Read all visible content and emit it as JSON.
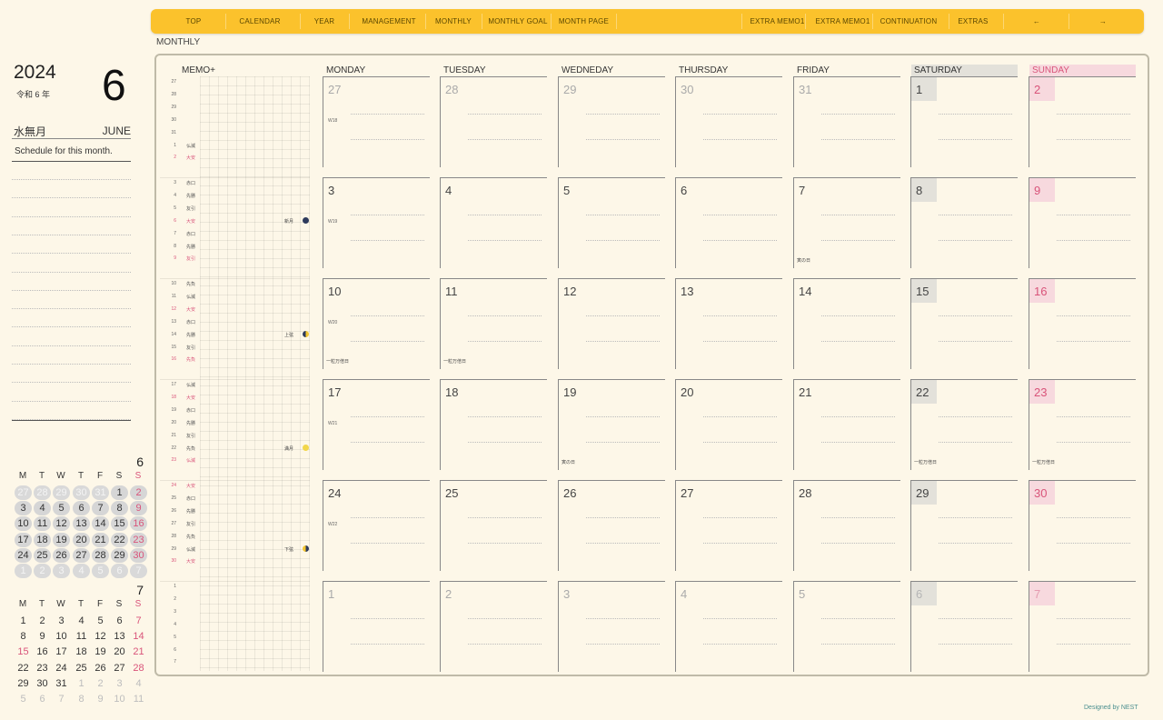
{
  "nav": {
    "items": [
      "TOP",
      "CALENDAR",
      "YEAR",
      "MANAGEMENT",
      "MONTHLY",
      "MONTHLY GOAL",
      "MONTH PAGE",
      "EXTRA MEMO1",
      "EXTRA MEMO1",
      "CONTINUATION",
      "EXTRAS",
      "←",
      "→"
    ]
  },
  "page_label": "MONTHLY",
  "header": {
    "year": "2024",
    "era": "令和 6 年",
    "month_number": "6",
    "month_jp": "水無月",
    "month_en": "JUNE",
    "schedule_title": "Schedule for this month."
  },
  "mini_calendars": [
    {
      "label": "6",
      "weekdays": [
        "M",
        "T",
        "W",
        "T",
        "F",
        "S",
        "S"
      ],
      "shaded": true,
      "weeks": [
        [
          {
            "d": "27",
            "g": true
          },
          {
            "d": "28",
            "g": true
          },
          {
            "d": "29",
            "g": true
          },
          {
            "d": "30",
            "g": true
          },
          {
            "d": "31",
            "g": true
          },
          {
            "d": "1"
          },
          {
            "d": "2"
          }
        ],
        [
          {
            "d": "3"
          },
          {
            "d": "4"
          },
          {
            "d": "5"
          },
          {
            "d": "6"
          },
          {
            "d": "7"
          },
          {
            "d": "8"
          },
          {
            "d": "9"
          }
        ],
        [
          {
            "d": "10"
          },
          {
            "d": "11"
          },
          {
            "d": "12"
          },
          {
            "d": "13"
          },
          {
            "d": "14"
          },
          {
            "d": "15"
          },
          {
            "d": "16"
          }
        ],
        [
          {
            "d": "17"
          },
          {
            "d": "18"
          },
          {
            "d": "19"
          },
          {
            "d": "20"
          },
          {
            "d": "21"
          },
          {
            "d": "22"
          },
          {
            "d": "23"
          }
        ],
        [
          {
            "d": "24"
          },
          {
            "d": "25"
          },
          {
            "d": "26"
          },
          {
            "d": "27"
          },
          {
            "d": "28"
          },
          {
            "d": "29"
          },
          {
            "d": "30"
          }
        ],
        [
          {
            "d": "1",
            "g": true
          },
          {
            "d": "2",
            "g": true
          },
          {
            "d": "3",
            "g": true
          },
          {
            "d": "4",
            "g": true
          },
          {
            "d": "5",
            "g": true
          },
          {
            "d": "6",
            "g": true
          },
          {
            "d": "7",
            "g": true
          }
        ]
      ]
    },
    {
      "label": "7",
      "weekdays": [
        "M",
        "T",
        "W",
        "T",
        "F",
        "S",
        "S"
      ],
      "shaded": false,
      "weeks": [
        [
          {
            "d": "1"
          },
          {
            "d": "2"
          },
          {
            "d": "3"
          },
          {
            "d": "4"
          },
          {
            "d": "5"
          },
          {
            "d": "6"
          },
          {
            "d": "7"
          }
        ],
        [
          {
            "d": "8"
          },
          {
            "d": "9"
          },
          {
            "d": "10"
          },
          {
            "d": "11"
          },
          {
            "d": "12"
          },
          {
            "d": "13"
          },
          {
            "d": "14"
          }
        ],
        [
          {
            "d": "15",
            "r": true
          },
          {
            "d": "16"
          },
          {
            "d": "17"
          },
          {
            "d": "18"
          },
          {
            "d": "19"
          },
          {
            "d": "20"
          },
          {
            "d": "21"
          }
        ],
        [
          {
            "d": "22"
          },
          {
            "d": "23"
          },
          {
            "d": "24"
          },
          {
            "d": "25"
          },
          {
            "d": "26"
          },
          {
            "d": "27"
          },
          {
            "d": "28"
          }
        ],
        [
          {
            "d": "29"
          },
          {
            "d": "30"
          },
          {
            "d": "31"
          },
          {
            "d": "1",
            "g": true
          },
          {
            "d": "2",
            "g": true
          },
          {
            "d": "3",
            "g": true
          },
          {
            "d": "4",
            "g": true
          }
        ],
        [
          {
            "d": "5",
            "g": true
          },
          {
            "d": "6",
            "g": true
          },
          {
            "d": "7",
            "g": true
          },
          {
            "d": "8",
            "g": true
          },
          {
            "d": "9",
            "g": true
          },
          {
            "d": "10",
            "g": true
          },
          {
            "d": "11",
            "g": true
          }
        ]
      ]
    }
  ],
  "memo": {
    "label": "MEMO+",
    "blocks": [
      [
        {
          "d": "27"
        },
        {
          "d": "28"
        },
        {
          "d": "29"
        },
        {
          "d": "30"
        },
        {
          "d": "31"
        },
        {
          "d": "1",
          "r": "仏滅"
        },
        {
          "d": "2",
          "r": "大安",
          "red": true
        }
      ],
      [
        {
          "d": "3",
          "r": "赤口"
        },
        {
          "d": "4",
          "r": "先勝"
        },
        {
          "d": "5",
          "r": "友引"
        },
        {
          "d": "6",
          "r": "大安",
          "red": true,
          "moon": "新月"
        },
        {
          "d": "7",
          "r": "赤口"
        },
        {
          "d": "8",
          "r": "先勝"
        },
        {
          "d": "9",
          "r": "友引",
          "red": true
        }
      ],
      [
        {
          "d": "10",
          "r": "先負"
        },
        {
          "d": "11",
          "r": "仏滅"
        },
        {
          "d": "12",
          "r": "大安",
          "red": true
        },
        {
          "d": "13",
          "r": "赤口"
        },
        {
          "d": "14",
          "r": "先勝",
          "moon": "上弦"
        },
        {
          "d": "15",
          "r": "友引"
        },
        {
          "d": "16",
          "r": "先負",
          "red": true
        }
      ],
      [
        {
          "d": "17",
          "r": "仏滅"
        },
        {
          "d": "18",
          "r": "大安",
          "red": true
        },
        {
          "d": "19",
          "r": "赤口"
        },
        {
          "d": "20",
          "r": "先勝"
        },
        {
          "d": "21",
          "r": "友引"
        },
        {
          "d": "22",
          "r": "先負",
          "moon": "満月"
        },
        {
          "d": "23",
          "r": "仏滅",
          "red": true
        }
      ],
      [
        {
          "d": "24",
          "r": "大安",
          "red": true
        },
        {
          "d": "25",
          "r": "赤口"
        },
        {
          "d": "26",
          "r": "先勝"
        },
        {
          "d": "27",
          "r": "友引"
        },
        {
          "d": "28",
          "r": "先負"
        },
        {
          "d": "29",
          "r": "仏滅",
          "moon": "下弦"
        },
        {
          "d": "30",
          "r": "大安",
          "red": true
        }
      ],
      [
        {
          "d": "1"
        },
        {
          "d": "2"
        },
        {
          "d": "3"
        },
        {
          "d": "4"
        },
        {
          "d": "5"
        },
        {
          "d": "6"
        },
        {
          "d": "7"
        }
      ]
    ]
  },
  "weekday_headers": [
    "MONDAY",
    "TUESDAY",
    "WEDNEDAY",
    "THURSDAY",
    "FRIDAY",
    "SATURDAY",
    "SUNDAY"
  ],
  "weeks": [
    {
      "week": "W18",
      "days": [
        {
          "d": "27",
          "g": true
        },
        {
          "d": "28",
          "g": true
        },
        {
          "d": "29",
          "g": true
        },
        {
          "d": "30",
          "g": true
        },
        {
          "d": "31",
          "g": true
        },
        {
          "d": "1"
        },
        {
          "d": "2"
        }
      ]
    },
    {
      "week": "W19",
      "days": [
        {
          "d": "3"
        },
        {
          "d": "4"
        },
        {
          "d": "5"
        },
        {
          "d": "6"
        },
        {
          "d": "7",
          "note": "寅の日"
        },
        {
          "d": "8"
        },
        {
          "d": "9"
        }
      ]
    },
    {
      "week": "W20",
      "days": [
        {
          "d": "10",
          "note": "一粒万倍日"
        },
        {
          "d": "11",
          "note": "一粒万倍日"
        },
        {
          "d": "12"
        },
        {
          "d": "13"
        },
        {
          "d": "14"
        },
        {
          "d": "15"
        },
        {
          "d": "16"
        }
      ]
    },
    {
      "week": "W21",
      "days": [
        {
          "d": "17"
        },
        {
          "d": "18"
        },
        {
          "d": "19",
          "note": "寅の日"
        },
        {
          "d": "20"
        },
        {
          "d": "21"
        },
        {
          "d": "22",
          "note": "一粒万倍日"
        },
        {
          "d": "23",
          "note": "一粒万倍日"
        }
      ]
    },
    {
      "week": "W22",
      "days": [
        {
          "d": "24"
        },
        {
          "d": "25"
        },
        {
          "d": "26"
        },
        {
          "d": "27"
        },
        {
          "d": "28"
        },
        {
          "d": "29"
        },
        {
          "d": "30"
        }
      ]
    },
    {
      "week": "",
      "days": [
        {
          "d": "1",
          "g": true
        },
        {
          "d": "2",
          "g": true
        },
        {
          "d": "3",
          "g": true
        },
        {
          "d": "4",
          "g": true
        },
        {
          "d": "5",
          "g": true
        },
        {
          "d": "6",
          "g": true
        },
        {
          "d": "7",
          "g": true
        }
      ]
    }
  ],
  "credit": "Designed by NEST",
  "colors": {
    "accent": "#fbc22c",
    "sunday": "#d9547a",
    "background": "#fdf7e8"
  }
}
